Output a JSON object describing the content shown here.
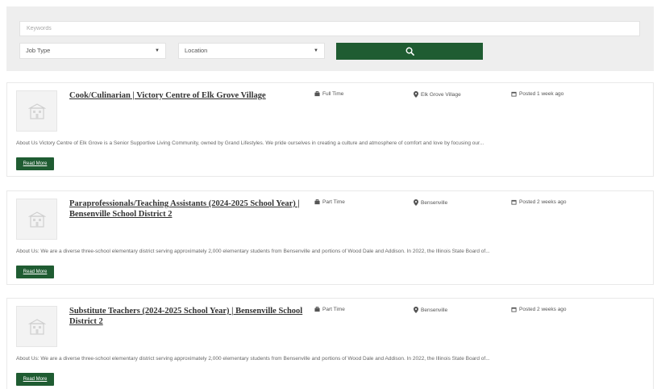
{
  "search": {
    "keywords_placeholder": "Keywords",
    "job_type": "Job Type",
    "location": "Location",
    "button_icon": "search-icon"
  },
  "colors": {
    "accent": "#1f5c32",
    "panel": "#eeeeee"
  },
  "jobs": [
    {
      "title": "Cook/Culinarian | Victory Centre of Elk Grove Village",
      "type": "Full Time",
      "location": "Elk Grove Village",
      "posted": "Posted 1 week ago",
      "description": "About Us Victory Centre of Elk Grove is a Senior Supportive Living Community, owned by Grand Lifestyles.  We pride ourselves in creating a culture and atmosphere of comfort and love by focusing our...",
      "read_more": "Read More"
    },
    {
      "title": "Paraprofessionals/Teaching Assistants (2024-2025 School Year) | Bensenville School District 2",
      "type": "Part Time",
      "location": "Bensenville",
      "posted": "Posted 2 weeks ago",
      "description": "About Us: We are a diverse three-school elementary district serving approximately 2,000 elementary students from Bensenville and portions of Wood Dale and Addison. In 2022, the Illinois State Board of...",
      "read_more": "Read More"
    },
    {
      "title": "Substitute Teachers (2024-2025 School Year) | Bensenville School District 2",
      "type": "Part Time",
      "location": "Bensenville",
      "posted": "Posted 2 weeks ago",
      "description": "About Us: We are a diverse three-school elementary district serving approximately 2,000 elementary students from Bensenville and portions of Wood Dale and Addison. In 2022, the Illinois State Board of...",
      "read_more": "Read More"
    }
  ]
}
